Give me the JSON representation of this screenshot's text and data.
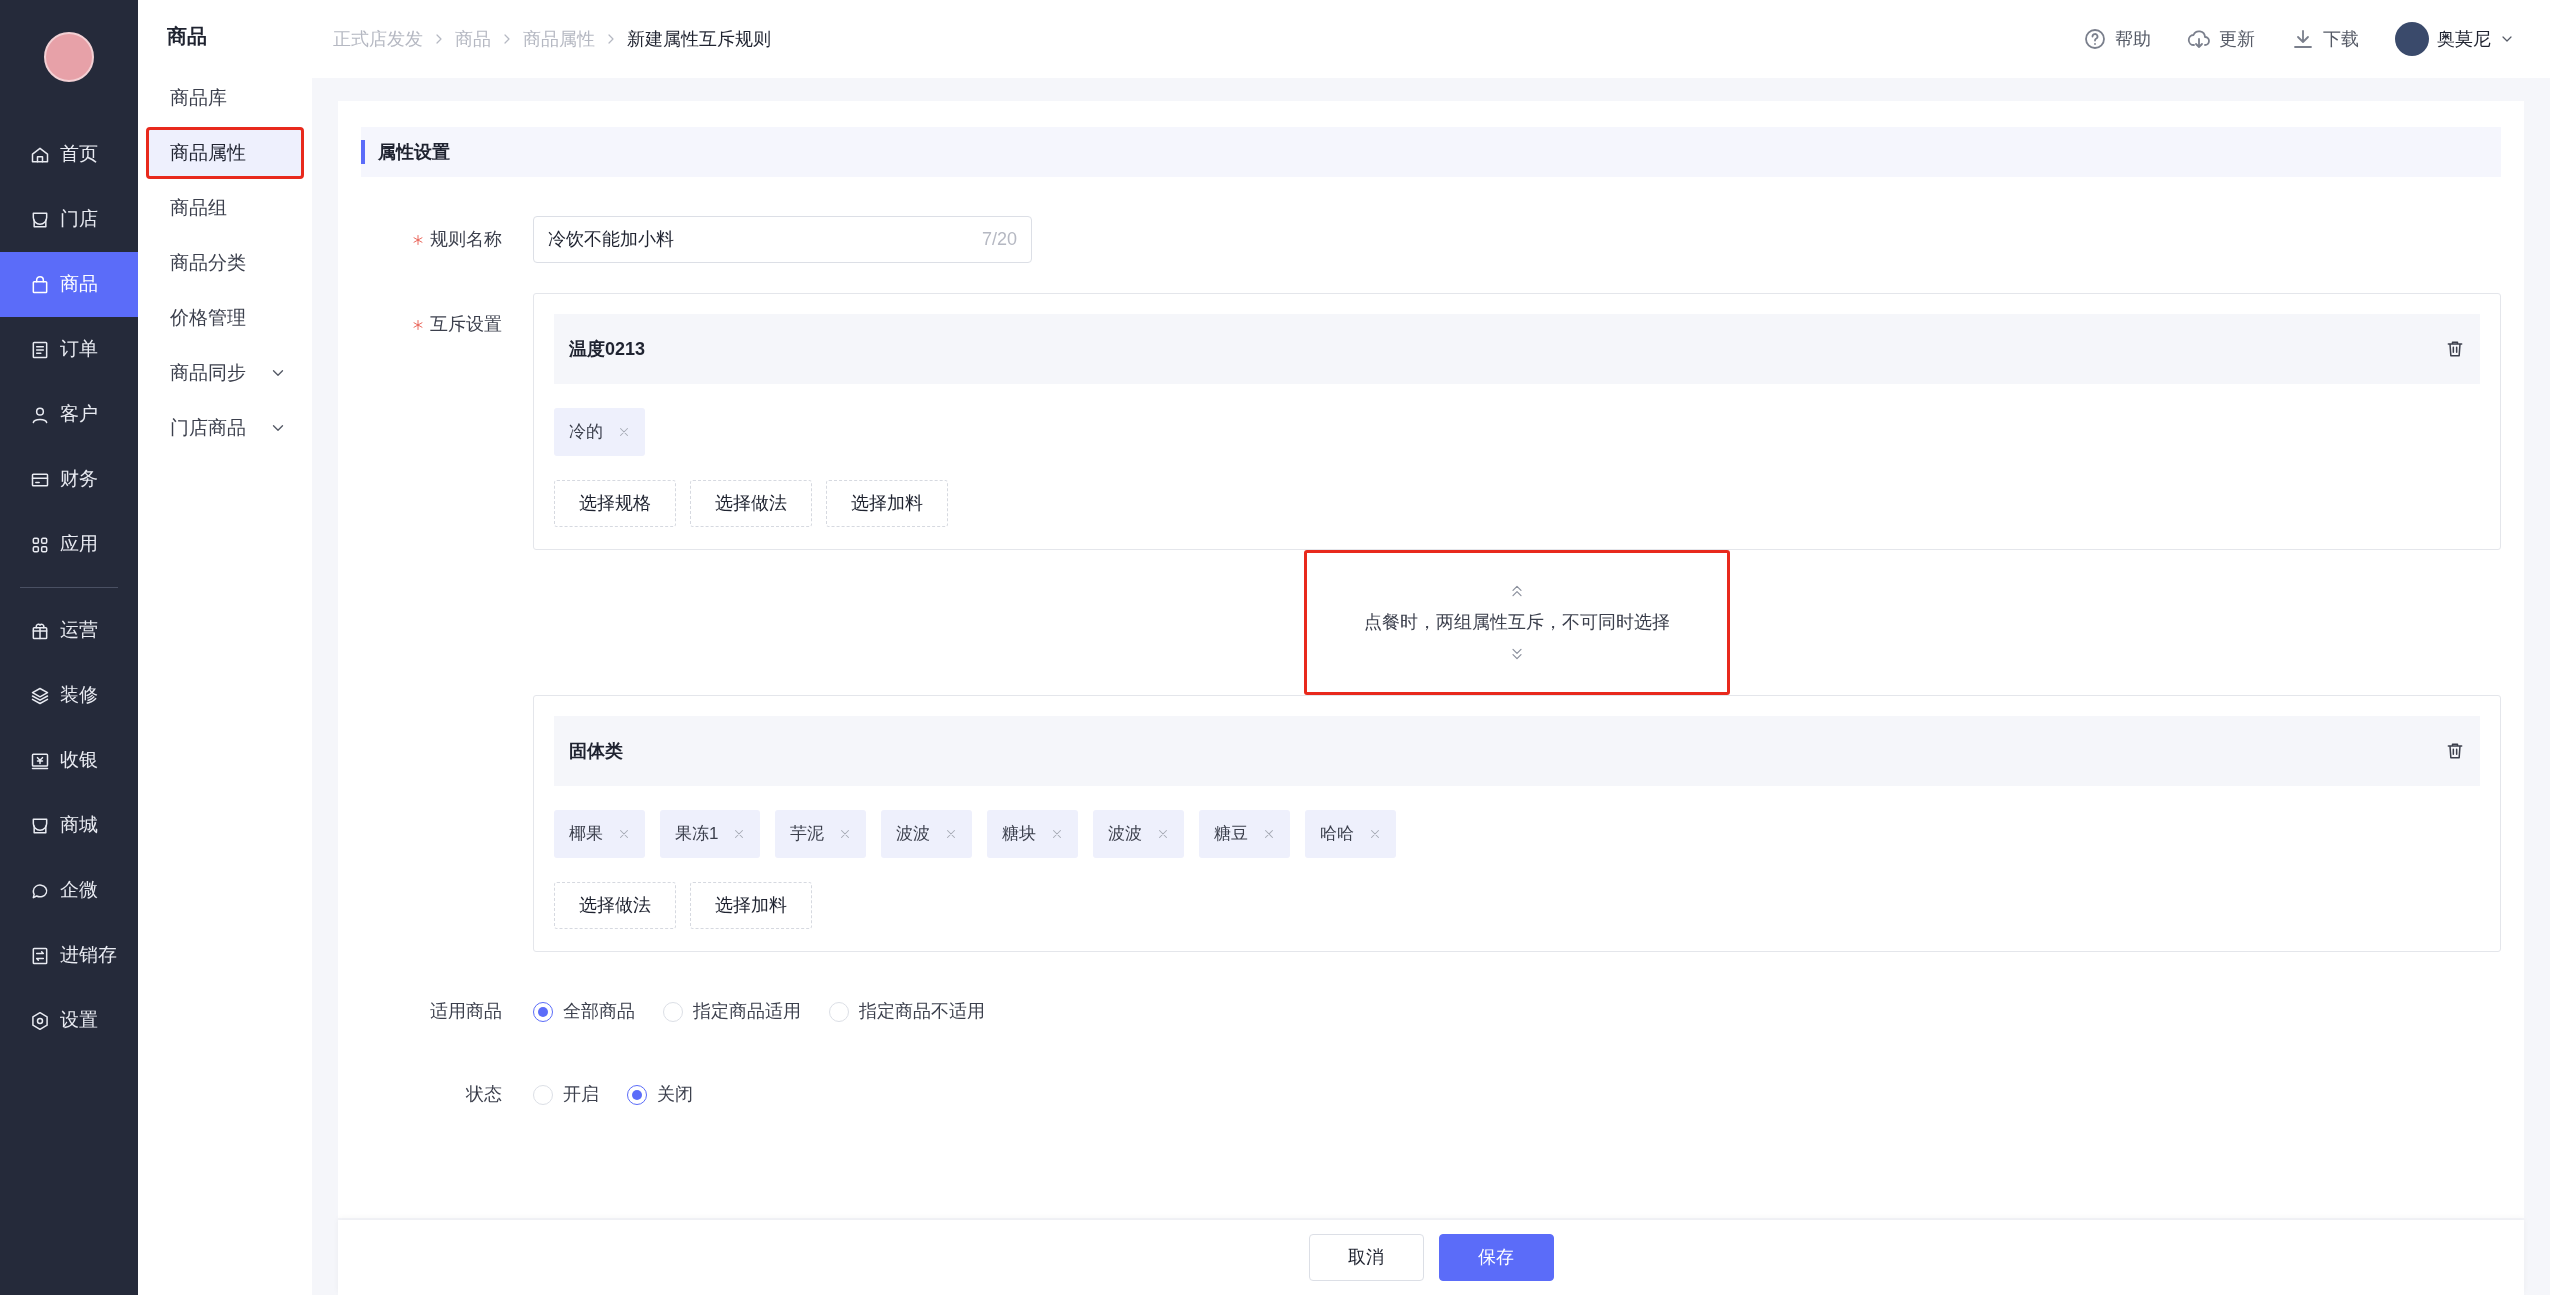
{
  "nav": {
    "primary": [
      {
        "label": "首页",
        "selected": false
      },
      {
        "label": "门店",
        "selected": false
      },
      {
        "label": "商品",
        "selected": true
      },
      {
        "label": "订单",
        "selected": false
      },
      {
        "label": "客户",
        "selected": false
      },
      {
        "label": "财务",
        "selected": false
      },
      {
        "label": "应用",
        "selected": false
      }
    ],
    "secondary": [
      {
        "label": "运营",
        "selected": false
      },
      {
        "label": "装修",
        "selected": false
      },
      {
        "label": "收银",
        "selected": false
      },
      {
        "label": "商城",
        "selected": false
      },
      {
        "label": "企微",
        "selected": false
      },
      {
        "label": "进销存",
        "selected": false
      },
      {
        "label": "设置",
        "selected": false
      }
    ]
  },
  "subnav": {
    "title": "商品",
    "items": [
      {
        "label": "商品库",
        "selected": false,
        "expandable": false,
        "highlighted": false
      },
      {
        "label": "商品属性",
        "selected": true,
        "expandable": false,
        "highlighted": true
      },
      {
        "label": "商品组",
        "selected": false,
        "expandable": false,
        "highlighted": false
      },
      {
        "label": "商品分类",
        "selected": false,
        "expandable": false,
        "highlighted": false
      },
      {
        "label": "价格管理",
        "selected": false,
        "expandable": false,
        "highlighted": false
      },
      {
        "label": "商品同步",
        "selected": false,
        "expandable": true,
        "highlighted": false
      },
      {
        "label": "门店商品",
        "selected": false,
        "expandable": true,
        "highlighted": false
      }
    ]
  },
  "breadcrumb": [
    "正式店发发",
    "商品",
    "商品属性",
    "新建属性互斥规则"
  ],
  "header_actions": [
    "帮助",
    "更新",
    "下载"
  ],
  "user": {
    "name": "奥莫尼"
  },
  "section_title": "属性设置",
  "rule_name": {
    "label": "规则名称",
    "required": true,
    "value": "冷饮不能加小料",
    "counter": "7/20"
  },
  "mutex": {
    "label": "互斥设置",
    "required": true,
    "groups": [
      {
        "title": "温度0213",
        "tags": [
          "冷的"
        ],
        "buttons": [
          "选择规格",
          "选择做法",
          "选择加料"
        ]
      },
      {
        "title": "固体类",
        "tags": [
          "椰果",
          "果冻1",
          "芋泥",
          "波波",
          "糖块",
          "波波",
          "糖豆",
          "哈哈"
        ],
        "buttons": [
          "选择做法",
          "选择加料"
        ]
      }
    ],
    "note": "点餐时，两组属性互斥，不可同时选择",
    "note_highlighted": true
  },
  "applicable": {
    "label": "适用商品",
    "options": [
      {
        "label": "全部商品",
        "selected": true
      },
      {
        "label": "指定商品适用",
        "selected": false
      },
      {
        "label": "指定商品不适用",
        "selected": false
      }
    ]
  },
  "status": {
    "label": "状态",
    "options": [
      {
        "label": "开启",
        "selected": false
      },
      {
        "label": "关闭",
        "selected": true
      }
    ]
  },
  "footer_buttons": [
    {
      "label": "取消",
      "kind": "secondary"
    },
    {
      "label": "保存",
      "kind": "primary"
    }
  ]
}
